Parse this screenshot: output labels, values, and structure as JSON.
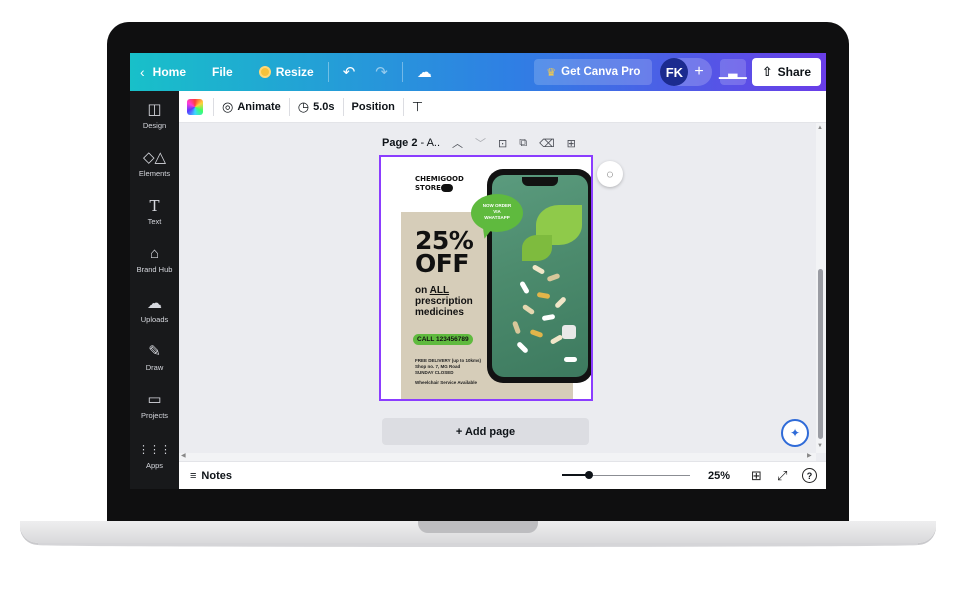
{
  "topbar": {
    "home": "Home",
    "file": "File",
    "resize": "Resize",
    "pro": "Get Canva Pro",
    "avatar_initials": "FK",
    "share": "Share"
  },
  "sidebar": {
    "items": [
      {
        "label": "Design",
        "icon": "layout-icon"
      },
      {
        "label": "Elements",
        "icon": "shapes-icon"
      },
      {
        "label": "Text",
        "icon": "text-icon"
      },
      {
        "label": "Brand Hub",
        "icon": "brand-icon"
      },
      {
        "label": "Uploads",
        "icon": "upload-icon"
      },
      {
        "label": "Draw",
        "icon": "draw-icon"
      },
      {
        "label": "Projects",
        "icon": "folder-icon"
      },
      {
        "label": "Apps",
        "icon": "grid-icon"
      }
    ]
  },
  "toolbar": {
    "animate": "Animate",
    "duration": "5.0s",
    "position": "Position"
  },
  "page": {
    "label": "Page 2",
    "title": "- A.."
  },
  "design": {
    "brand_line1": "CHEMIGOOD",
    "brand_line2": "STORE",
    "bubble_line1": "NOW ORDER",
    "bubble_line2": "VIA",
    "bubble_line3": "WHATSAPP",
    "headline_line1": "25%",
    "headline_line2": "OFF",
    "sub_on": "on",
    "sub_all": "ALL",
    "sub_line2": "prescription",
    "sub_line3": "medicines",
    "call": "CALL 123456789",
    "fine1": "FREE DELIVERY (up to 10kms)",
    "fine2": "Shop no. 7, MG Road",
    "fine3": "SUNDAY CLOSED",
    "fine4": "Wheelchair Service Available"
  },
  "canvas": {
    "add_page": "+ Add page"
  },
  "bottombar": {
    "notes": "Notes",
    "zoom": "25%",
    "zoom_value": 0.25
  },
  "colors": {
    "accent": "#8b3dff",
    "pill_green": "#5fba3e",
    "beige": "#d6cdb9"
  }
}
